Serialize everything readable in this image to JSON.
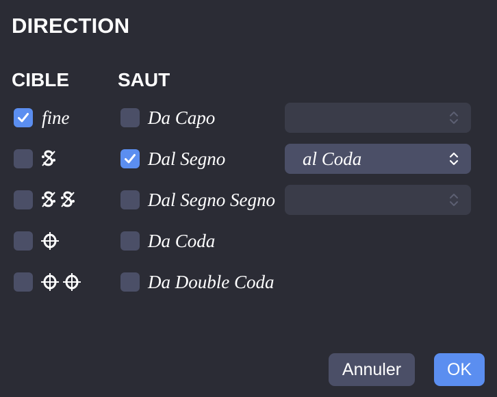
{
  "dialog": {
    "title": "DIRECTION"
  },
  "target": {
    "header": "CIBLE",
    "items": [
      {
        "label": "fine",
        "checked": true,
        "icon": ""
      },
      {
        "label": "",
        "checked": false,
        "icon": "segno-icon"
      },
      {
        "label": "",
        "checked": false,
        "icon": "double-segno-icon"
      },
      {
        "label": "",
        "checked": false,
        "icon": "coda-icon"
      },
      {
        "label": "",
        "checked": false,
        "icon": "double-coda-icon"
      }
    ]
  },
  "jump": {
    "header": "SAUT",
    "items": [
      {
        "label": "Da Capo",
        "checked": false
      },
      {
        "label": "Dal Segno",
        "checked": true
      },
      {
        "label": "Dal Segno Segno",
        "checked": false
      },
      {
        "label": "Da Coda",
        "checked": false
      },
      {
        "label": "Da Double Coda",
        "checked": false
      }
    ]
  },
  "selects": [
    {
      "value": "",
      "enabled": false
    },
    {
      "value": "al Coda",
      "enabled": true
    },
    {
      "value": "",
      "enabled": false
    }
  ],
  "buttons": {
    "cancel_label": "Annuler",
    "ok_label": "OK"
  },
  "colors": {
    "background": "#2b2c35",
    "accent": "#5b8ef0",
    "control": "#4b4f67",
    "control_disabled": "#3a3c49"
  }
}
